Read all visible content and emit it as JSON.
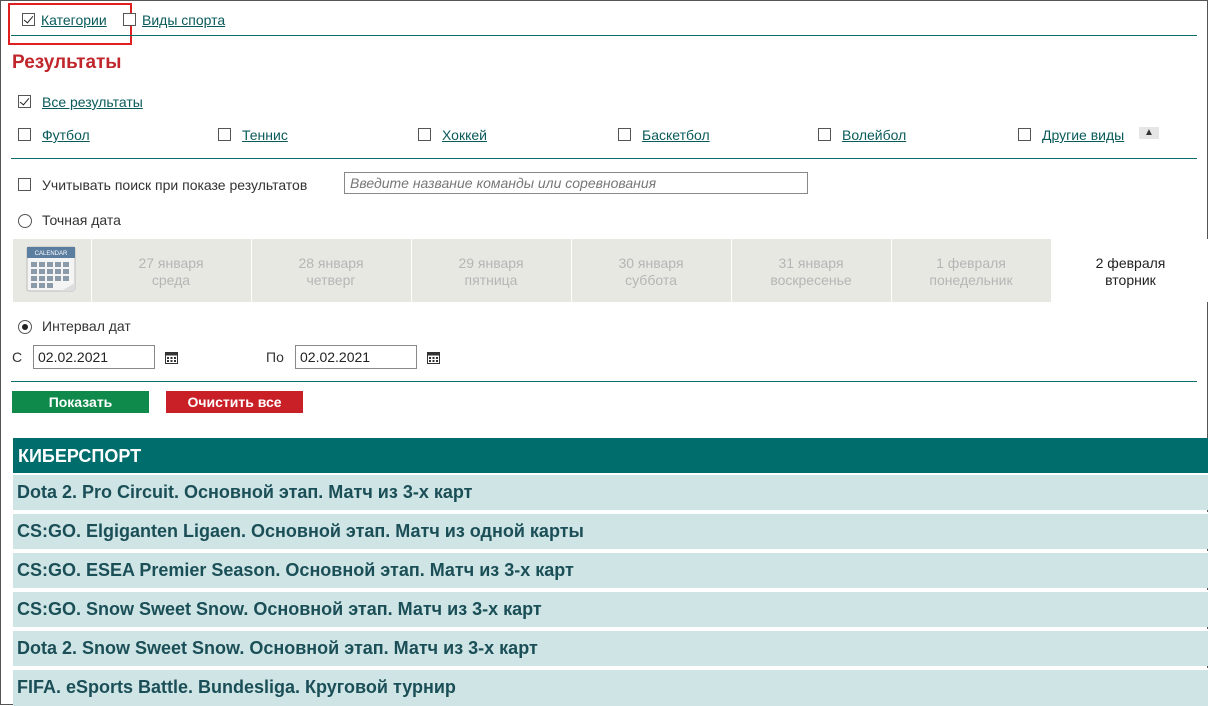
{
  "top_tabs": {
    "categories_label": "Категории",
    "sports_label": "Виды спорта"
  },
  "results": {
    "title": "Результаты",
    "all_label": "Все результаты",
    "sports": [
      "Футбол",
      "Теннис",
      "Хоккей",
      "Баскетбол",
      "Волейбол",
      "Другие виды"
    ]
  },
  "search": {
    "consider_label": "Учитывать поиск при показе результатов",
    "placeholder": "Введите название команды или соревнования"
  },
  "exact_date": {
    "label": "Точная дата",
    "calendar_label": "CALENDAR",
    "days": [
      {
        "date": "27 января",
        "weekday": "среда"
      },
      {
        "date": "28 января",
        "weekday": "четверг"
      },
      {
        "date": "29 января",
        "weekday": "пятница"
      },
      {
        "date": "30 января",
        "weekday": "суббота"
      },
      {
        "date": "31 января",
        "weekday": "воскресенье"
      },
      {
        "date": "1 февраля",
        "weekday": "понедельник"
      },
      {
        "date": "2 февраля",
        "weekday": "вторник"
      }
    ]
  },
  "interval": {
    "label": "Интервал дат",
    "from_label": "С",
    "from_value": "02.02.2021",
    "to_label": "По",
    "to_value": "02.02.2021"
  },
  "buttons": {
    "show": "Показать",
    "clear": "Очистить все",
    "show_color": "#0f8a4a",
    "clear_color": "#c91f27"
  },
  "category": {
    "title": "КИБЕРСПОРТ",
    "rows": [
      "Dota 2. Pro Circuit. Основной этап. Матч из 3-х карт",
      "CS:GO. Elgiganten Ligaen. Основной этап. Матч из одной карты",
      "CS:GO. ESEA Premier Season. Основной этап. Матч из 3-х карт",
      "CS:GO. Snow Sweet Snow. Основной этап. Матч из 3-х карт",
      "Dota 2. Snow Sweet Snow. Основной этап. Матч из 3-х карт",
      "FIFA. eSports Battle. Bundesliga. Круговой турнир"
    ]
  }
}
